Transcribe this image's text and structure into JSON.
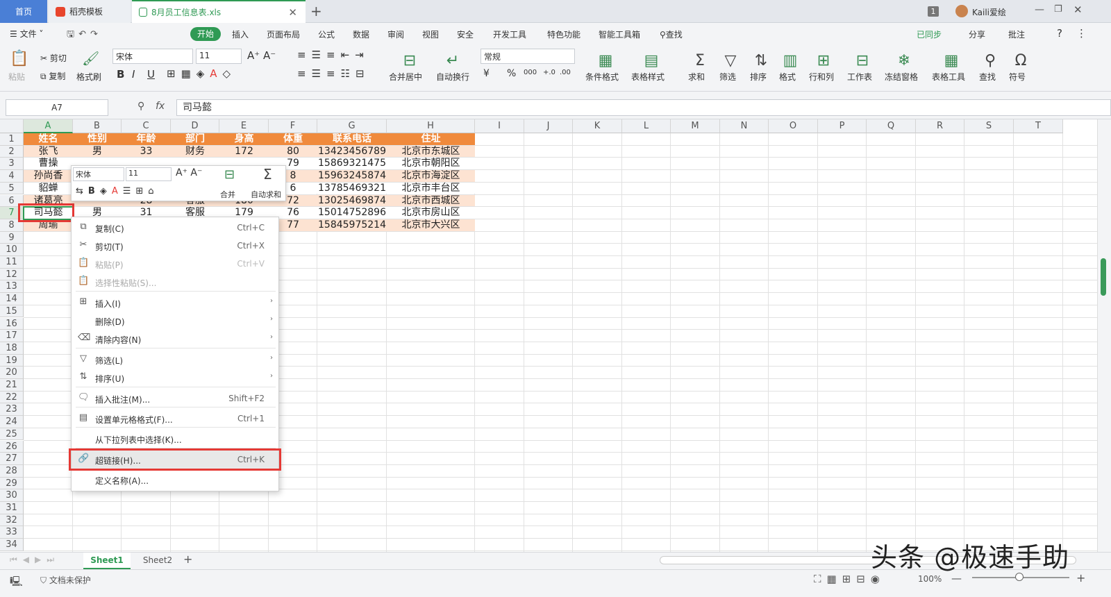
{
  "tabs": {
    "home": "首页",
    "docer": "稻壳模板",
    "file": "8月员工信息表.xls",
    "new_tab": "+"
  },
  "titlebar": {
    "window_count": "1",
    "user": "Kaili爱绘"
  },
  "menu": {
    "file": "文件",
    "start": "开始",
    "items": [
      "插入",
      "页面布局",
      "公式",
      "数据",
      "审阅",
      "视图",
      "安全",
      "开发工具",
      "特色功能",
      "智能工具箱"
    ],
    "search": "查找",
    "sync": "已同步",
    "share": "分享",
    "comment": "批注",
    "help": "?"
  },
  "ribbon": {
    "paste": "粘贴",
    "cut": "剪切",
    "copy": "复制",
    "format_painter": "格式刷",
    "font": "宋体",
    "size": "11",
    "merge_center": "合并居中",
    "wrap": "自动换行",
    "number_format": "常规",
    "cond_format": "条件格式",
    "table_style": "表格样式",
    "sum": "求和",
    "filter": "筛选",
    "sort": "排序",
    "format": "格式",
    "rowcol": "行和列",
    "worksheet": "工作表",
    "freeze": "冻结窗格",
    "table_tool": "表格工具",
    "find": "查找",
    "symbol": "符号",
    "bold": "B",
    "italic": "I",
    "underline": "U",
    "percent": "%",
    "thousands": "000",
    "inc_dec": "+.0 .00",
    "dec_dec": ".00 +.0"
  },
  "formula_bar": {
    "name_box": "A7",
    "fx": "fx",
    "content": "司马懿"
  },
  "columns": [
    "A",
    "B",
    "C",
    "D",
    "E",
    "F",
    "G",
    "H",
    "I",
    "J",
    "K",
    "L",
    "M",
    "N",
    "O",
    "P",
    "Q",
    "R",
    "S",
    "T"
  ],
  "rows": [
    "1",
    "2",
    "3",
    "4",
    "5",
    "6",
    "7",
    "8",
    "9",
    "10",
    "11",
    "12",
    "13",
    "14",
    "15",
    "16",
    "17",
    "18",
    "19",
    "20",
    "21",
    "22",
    "23",
    "24",
    "25",
    "26",
    "27",
    "28",
    "29",
    "30",
    "31",
    "32",
    "33",
    "34"
  ],
  "table": {
    "headers": [
      "姓名",
      "性别",
      "年龄",
      "部门",
      "身高",
      "体重",
      "联系电话",
      "住址"
    ],
    "rows": [
      [
        "张飞",
        "男",
        "33",
        "财务",
        "172",
        "80",
        "13423456789",
        "北京市东城区"
      ],
      [
        "曹操",
        "",
        "",
        "",
        "",
        "79",
        "15869321475",
        "北京市朝阳区"
      ],
      [
        "孙尚香",
        "",
        "",
        "",
        "",
        "8",
        "15963245874",
        "北京市海淀区"
      ],
      [
        "貂蝉",
        "",
        "",
        "",
        "",
        "6",
        "13785469321",
        "北京市丰台区"
      ],
      [
        "诸葛亮",
        "",
        "28",
        "客服",
        "180",
        "72",
        "13025469874",
        "北京市西城区"
      ],
      [
        "司马懿",
        "男",
        "31",
        "客服",
        "179",
        "76",
        "15014752896",
        "北京市房山区"
      ],
      [
        "周瑜",
        "",
        "",
        "",
        "",
        "77",
        "15845975214",
        "北京市大兴区"
      ]
    ],
    "header_color": "#f08a3c",
    "band_color": "#fde3d2"
  },
  "mini_toolbar": {
    "font": "宋体",
    "size": "11",
    "bold": "B",
    "merge": "合并",
    "autosum": "自动求和"
  },
  "context_menu": [
    {
      "label": "复制(C)",
      "shortcut": "Ctrl+C",
      "icon": "copy-icon",
      "enabled": true
    },
    {
      "label": "剪切(T)",
      "shortcut": "Ctrl+X",
      "icon": "cut-icon",
      "enabled": true
    },
    {
      "label": "粘贴(P)",
      "shortcut": "Ctrl+V",
      "icon": "paste-icon",
      "enabled": false
    },
    {
      "label": "选择性粘贴(S)...",
      "shortcut": "",
      "icon": "paste-special-icon",
      "enabled": false
    },
    {
      "label": "插入(I)",
      "shortcut": "",
      "icon": "insert-icon",
      "enabled": true,
      "submenu": true
    },
    {
      "label": "删除(D)",
      "shortcut": "",
      "icon": "",
      "enabled": true,
      "submenu": true
    },
    {
      "label": "清除内容(N)",
      "shortcut": "",
      "icon": "eraser-icon",
      "enabled": true,
      "submenu": true
    },
    {
      "label": "筛选(L)",
      "shortcut": "",
      "icon": "filter-icon",
      "enabled": true,
      "submenu": true
    },
    {
      "label": "排序(U)",
      "shortcut": "",
      "icon": "sort-icon",
      "enabled": true,
      "submenu": true
    },
    {
      "label": "插入批注(M)...",
      "shortcut": "Shift+F2",
      "icon": "comment-icon",
      "enabled": true
    },
    {
      "label": "设置单元格格式(F)...",
      "shortcut": "Ctrl+1",
      "icon": "format-cells-icon",
      "enabled": true
    },
    {
      "label": "从下拉列表中选择(K)...",
      "shortcut": "",
      "icon": "",
      "enabled": true
    },
    {
      "label": "超链接(H)...",
      "shortcut": "Ctrl+K",
      "icon": "link-icon",
      "enabled": true,
      "highlight": true
    },
    {
      "label": "定义名称(A)...",
      "shortcut": "",
      "icon": "",
      "enabled": true
    }
  ],
  "sheets": [
    "Sheet1",
    "Sheet2"
  ],
  "status": {
    "protect": "文档未保护",
    "zoom": "100%"
  },
  "watermark": "头条 @极速手助"
}
